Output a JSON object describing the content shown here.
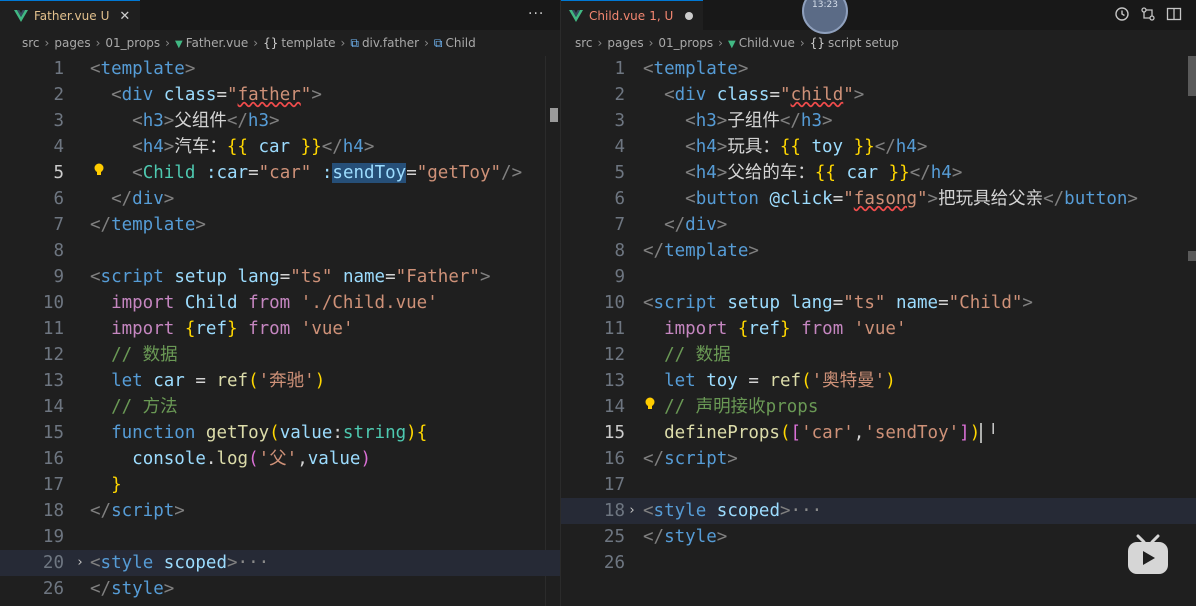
{
  "left": {
    "tab": {
      "label": "Father.vue",
      "status": "U",
      "close": "✕"
    },
    "more": "···",
    "breadcrumb": [
      "src",
      "pages",
      "01_props",
      "Father.vue",
      "template",
      "div.father",
      "Child"
    ],
    "lines": [
      {
        "n": "1",
        "tokens": [
          [
            "br",
            "<"
          ],
          [
            "tag",
            "template"
          ],
          [
            "br",
            ">"
          ]
        ]
      },
      {
        "n": "2",
        "tokens": [
          [
            "txt",
            "  "
          ],
          [
            "br",
            "<"
          ],
          [
            "tag",
            "div"
          ],
          [
            "txt",
            " "
          ],
          [
            "attr",
            "class"
          ],
          [
            "txt",
            "="
          ],
          [
            "str",
            "\""
          ],
          [
            "strsq",
            "father"
          ],
          [
            "str",
            "\""
          ],
          [
            "br",
            ">"
          ]
        ]
      },
      {
        "n": "3",
        "tokens": [
          [
            "txt",
            "    "
          ],
          [
            "br",
            "<"
          ],
          [
            "tag",
            "h3"
          ],
          [
            "br",
            ">"
          ],
          [
            "txt",
            "父组件"
          ],
          [
            "br",
            "</"
          ],
          [
            "tag",
            "h3"
          ],
          [
            "br",
            ">"
          ]
        ]
      },
      {
        "n": "4",
        "tokens": [
          [
            "txt",
            "    "
          ],
          [
            "br",
            "<"
          ],
          [
            "tag",
            "h4"
          ],
          [
            "br",
            ">"
          ],
          [
            "txt",
            "汽车："
          ],
          [
            "ws",
            "{{"
          ],
          [
            "txt",
            " "
          ],
          [
            "var",
            "car"
          ],
          [
            "txt",
            " "
          ],
          [
            "ws",
            "}}"
          ],
          [
            "br",
            "</"
          ],
          [
            "tag",
            "h4"
          ],
          [
            "br",
            ">"
          ]
        ]
      },
      {
        "n": "5",
        "tokens": [
          [
            "txt",
            "    "
          ],
          [
            "br",
            "<"
          ],
          [
            "cls",
            "Child"
          ],
          [
            "txt",
            " "
          ],
          [
            "attr",
            ":car"
          ],
          [
            "txt",
            "="
          ],
          [
            "str",
            "\"car\""
          ],
          [
            "txt",
            " "
          ],
          [
            "attr",
            ":"
          ],
          [
            "sel",
            "sendToy"
          ],
          [
            "txt",
            "="
          ],
          [
            "str",
            "\"getToy\""
          ],
          [
            "br",
            "/>"
          ]
        ]
      },
      {
        "n": "6",
        "tokens": [
          [
            "txt",
            "  "
          ],
          [
            "br",
            "</"
          ],
          [
            "tag",
            "div"
          ],
          [
            "br",
            ">"
          ]
        ]
      },
      {
        "n": "7",
        "tokens": [
          [
            "br",
            "</"
          ],
          [
            "tag",
            "template"
          ],
          [
            "br",
            ">"
          ]
        ]
      },
      {
        "n": "8",
        "tokens": []
      },
      {
        "n": "9",
        "tokens": [
          [
            "br",
            "<"
          ],
          [
            "tag",
            "script"
          ],
          [
            "txt",
            " "
          ],
          [
            "attr",
            "setup"
          ],
          [
            "txt",
            " "
          ],
          [
            "attr",
            "lang"
          ],
          [
            "txt",
            "="
          ],
          [
            "str",
            "\"ts\""
          ],
          [
            "txt",
            " "
          ],
          [
            "attr",
            "name"
          ],
          [
            "txt",
            "="
          ],
          [
            "str",
            "\"Father\""
          ],
          [
            "br",
            ">"
          ]
        ]
      },
      {
        "n": "10",
        "tokens": [
          [
            "txt",
            "  "
          ],
          [
            "ctl",
            "import"
          ],
          [
            "txt",
            " "
          ],
          [
            "var",
            "Child"
          ],
          [
            "txt",
            " "
          ],
          [
            "ctl",
            "from"
          ],
          [
            "txt",
            " "
          ],
          [
            "str",
            "'./Child.vue'"
          ]
        ]
      },
      {
        "n": "11",
        "tokens": [
          [
            "txt",
            "  "
          ],
          [
            "ctl",
            "import"
          ],
          [
            "txt",
            " "
          ],
          [
            "ws",
            "{"
          ],
          [
            "var",
            "ref"
          ],
          [
            "ws",
            "}"
          ],
          [
            "txt",
            " "
          ],
          [
            "ctl",
            "from"
          ],
          [
            "txt",
            " "
          ],
          [
            "str",
            "'vue'"
          ]
        ]
      },
      {
        "n": "12",
        "tokens": [
          [
            "txt",
            "  "
          ],
          [
            "com",
            "// 数据"
          ]
        ]
      },
      {
        "n": "13",
        "tokens": [
          [
            "txt",
            "  "
          ],
          [
            "kw",
            "let"
          ],
          [
            "txt",
            " "
          ],
          [
            "var",
            "car"
          ],
          [
            "txt",
            " = "
          ],
          [
            "fn",
            "ref"
          ],
          [
            "ws",
            "("
          ],
          [
            "str",
            "'奔驰'"
          ],
          [
            "ws",
            ")"
          ]
        ]
      },
      {
        "n": "14",
        "tokens": [
          [
            "txt",
            "  "
          ],
          [
            "com",
            "// 方法"
          ]
        ]
      },
      {
        "n": "15",
        "tokens": [
          [
            "txt",
            "  "
          ],
          [
            "kw",
            "function"
          ],
          [
            "txt",
            " "
          ],
          [
            "fn",
            "getToy"
          ],
          [
            "ws",
            "("
          ],
          [
            "var",
            "value"
          ],
          [
            "txt",
            ":"
          ],
          [
            "cls",
            "string"
          ],
          [
            "ws",
            ")"
          ],
          [
            "ws",
            "{"
          ]
        ]
      },
      {
        "n": "16",
        "tokens": [
          [
            "txt",
            "    "
          ],
          [
            "var",
            "console"
          ],
          [
            "txt",
            "."
          ],
          [
            "fn",
            "log"
          ],
          [
            "ws2",
            "("
          ],
          [
            "str",
            "'父'"
          ],
          [
            "txt",
            ","
          ],
          [
            "var",
            "value"
          ],
          [
            "ws2",
            ")"
          ]
        ]
      },
      {
        "n": "17",
        "tokens": [
          [
            "txt",
            "  "
          ],
          [
            "ws",
            "}"
          ]
        ]
      },
      {
        "n": "18",
        "tokens": [
          [
            "br",
            "</"
          ],
          [
            "tag",
            "script"
          ],
          [
            "br",
            ">"
          ]
        ]
      },
      {
        "n": "19",
        "tokens": []
      },
      {
        "n": "20",
        "tokens": [
          [
            "br",
            "<"
          ],
          [
            "tag",
            "style"
          ],
          [
            "txt",
            " "
          ],
          [
            "attr",
            "scoped"
          ],
          [
            "br",
            ">"
          ],
          [
            "ellip",
            "···"
          ]
        ]
      },
      {
        "n": "26",
        "tokens": [
          [
            "br",
            "</"
          ],
          [
            "tag",
            "style"
          ],
          [
            "br",
            ">"
          ]
        ]
      }
    ]
  },
  "right": {
    "tab": {
      "label": "Child.vue",
      "status": "1, U"
    },
    "breadcrumb": [
      "src",
      "pages",
      "01_props",
      "Child.vue",
      "script setup"
    ],
    "avatar_text": "13:23",
    "lines": [
      {
        "n": "1",
        "tokens": [
          [
            "br",
            "<"
          ],
          [
            "tag",
            "template"
          ],
          [
            "br",
            ">"
          ]
        ]
      },
      {
        "n": "2",
        "tokens": [
          [
            "txt",
            "  "
          ],
          [
            "br",
            "<"
          ],
          [
            "tag",
            "div"
          ],
          [
            "txt",
            " "
          ],
          [
            "attr",
            "class"
          ],
          [
            "txt",
            "="
          ],
          [
            "str",
            "\""
          ],
          [
            "strsq",
            "child"
          ],
          [
            "str",
            "\""
          ],
          [
            "br",
            ">"
          ]
        ]
      },
      {
        "n": "3",
        "tokens": [
          [
            "txt",
            "    "
          ],
          [
            "br",
            "<"
          ],
          [
            "tag",
            "h3"
          ],
          [
            "br",
            ">"
          ],
          [
            "txt",
            "子组件"
          ],
          [
            "br",
            "</"
          ],
          [
            "tag",
            "h3"
          ],
          [
            "br",
            ">"
          ]
        ]
      },
      {
        "n": "4",
        "tokens": [
          [
            "txt",
            "    "
          ],
          [
            "br",
            "<"
          ],
          [
            "tag",
            "h4"
          ],
          [
            "br",
            ">"
          ],
          [
            "txt",
            "玩具："
          ],
          [
            "ws",
            "{{"
          ],
          [
            "txt",
            " "
          ],
          [
            "var",
            "toy"
          ],
          [
            "txt",
            " "
          ],
          [
            "ws",
            "}}"
          ],
          [
            "br",
            "</"
          ],
          [
            "tag",
            "h4"
          ],
          [
            "br",
            ">"
          ]
        ]
      },
      {
        "n": "5",
        "tokens": [
          [
            "txt",
            "    "
          ],
          [
            "br",
            "<"
          ],
          [
            "tag",
            "h4"
          ],
          [
            "br",
            ">"
          ],
          [
            "txt",
            "父给的车："
          ],
          [
            "ws",
            "{{"
          ],
          [
            "txt",
            " "
          ],
          [
            "var",
            "car"
          ],
          [
            "txt",
            " "
          ],
          [
            "ws",
            "}}"
          ],
          [
            "br",
            "</"
          ],
          [
            "tag",
            "h4"
          ],
          [
            "br",
            ">"
          ]
        ]
      },
      {
        "n": "6",
        "tokens": [
          [
            "txt",
            "    "
          ],
          [
            "br",
            "<"
          ],
          [
            "tag",
            "button"
          ],
          [
            "txt",
            " "
          ],
          [
            "attr",
            "@click"
          ],
          [
            "txt",
            "="
          ],
          [
            "str",
            "\""
          ],
          [
            "strsq",
            "fasong"
          ],
          [
            "str",
            "\""
          ],
          [
            "br",
            ">"
          ],
          [
            "txt",
            "把玩具给父亲"
          ],
          [
            "br",
            "</"
          ],
          [
            "tag",
            "button"
          ],
          [
            "br",
            ">"
          ]
        ]
      },
      {
        "n": "7",
        "tokens": [
          [
            "txt",
            "  "
          ],
          [
            "br",
            "</"
          ],
          [
            "tag",
            "div"
          ],
          [
            "br",
            ">"
          ]
        ]
      },
      {
        "n": "8",
        "tokens": [
          [
            "br",
            "</"
          ],
          [
            "tag",
            "template"
          ],
          [
            "br",
            ">"
          ]
        ]
      },
      {
        "n": "9",
        "tokens": []
      },
      {
        "n": "10",
        "tokens": [
          [
            "br",
            "<"
          ],
          [
            "tag",
            "script"
          ],
          [
            "txt",
            " "
          ],
          [
            "attr",
            "setup"
          ],
          [
            "txt",
            " "
          ],
          [
            "attr",
            "lang"
          ],
          [
            "txt",
            "="
          ],
          [
            "str",
            "\"ts\""
          ],
          [
            "txt",
            " "
          ],
          [
            "attr",
            "name"
          ],
          [
            "txt",
            "="
          ],
          [
            "str",
            "\"Child\""
          ],
          [
            "br",
            ">"
          ]
        ]
      },
      {
        "n": "11",
        "tokens": [
          [
            "txt",
            "  "
          ],
          [
            "ctl",
            "import"
          ],
          [
            "txt",
            " "
          ],
          [
            "ws",
            "{"
          ],
          [
            "var",
            "ref"
          ],
          [
            "ws",
            "}"
          ],
          [
            "txt",
            " "
          ],
          [
            "ctl",
            "from"
          ],
          [
            "txt",
            " "
          ],
          [
            "str",
            "'vue'"
          ]
        ]
      },
      {
        "n": "12",
        "tokens": [
          [
            "txt",
            "  "
          ],
          [
            "com",
            "// 数据"
          ]
        ]
      },
      {
        "n": "13",
        "tokens": [
          [
            "txt",
            "  "
          ],
          [
            "kw",
            "let"
          ],
          [
            "txt",
            " "
          ],
          [
            "var",
            "toy"
          ],
          [
            "txt",
            " = "
          ],
          [
            "fn",
            "ref"
          ],
          [
            "ws",
            "("
          ],
          [
            "str",
            "'奥特曼'"
          ],
          [
            "ws",
            ")"
          ]
        ]
      },
      {
        "n": "14",
        "tokens": [
          [
            "txt",
            "  "
          ],
          [
            "com",
            "// 声明接收props"
          ]
        ]
      },
      {
        "n": "15",
        "tokens": [
          [
            "txt",
            "  "
          ],
          [
            "fn",
            "defineProps"
          ],
          [
            "ws",
            "("
          ],
          [
            "ws2",
            "["
          ],
          [
            "str",
            "'car'"
          ],
          [
            "txt",
            ","
          ],
          [
            "str",
            "'sendToy'"
          ],
          [
            "ws2",
            "]"
          ],
          [
            "ws",
            ")"
          ],
          [
            "cursor",
            ""
          ]
        ]
      },
      {
        "n": "16",
        "tokens": [
          [
            "br",
            "</"
          ],
          [
            "tag",
            "script"
          ],
          [
            "br",
            ">"
          ]
        ]
      },
      {
        "n": "17",
        "tokens": []
      },
      {
        "n": "18",
        "tokens": [
          [
            "br",
            "<"
          ],
          [
            "tag",
            "style"
          ],
          [
            "txt",
            " "
          ],
          [
            "attr",
            "scoped"
          ],
          [
            "br",
            ">"
          ],
          [
            "ellip",
            "···"
          ]
        ]
      },
      {
        "n": "25",
        "tokens": [
          [
            "br",
            "</"
          ],
          [
            "tag",
            "style"
          ],
          [
            "br",
            ">"
          ]
        ]
      },
      {
        "n": "26",
        "tokens": []
      }
    ]
  },
  "colors": {
    "background": "#1f1f1f",
    "tab_modified": "#e2c08d",
    "vue_green": "#41b883",
    "accent": "#0078d4"
  },
  "icons": [
    "vue-file-icon",
    "history-icon",
    "compare-icon",
    "split-editor-icon",
    "more-actions-icon",
    "lightbulb-icon",
    "fold-chevron-icon",
    "bilibili-tv-icon"
  ]
}
